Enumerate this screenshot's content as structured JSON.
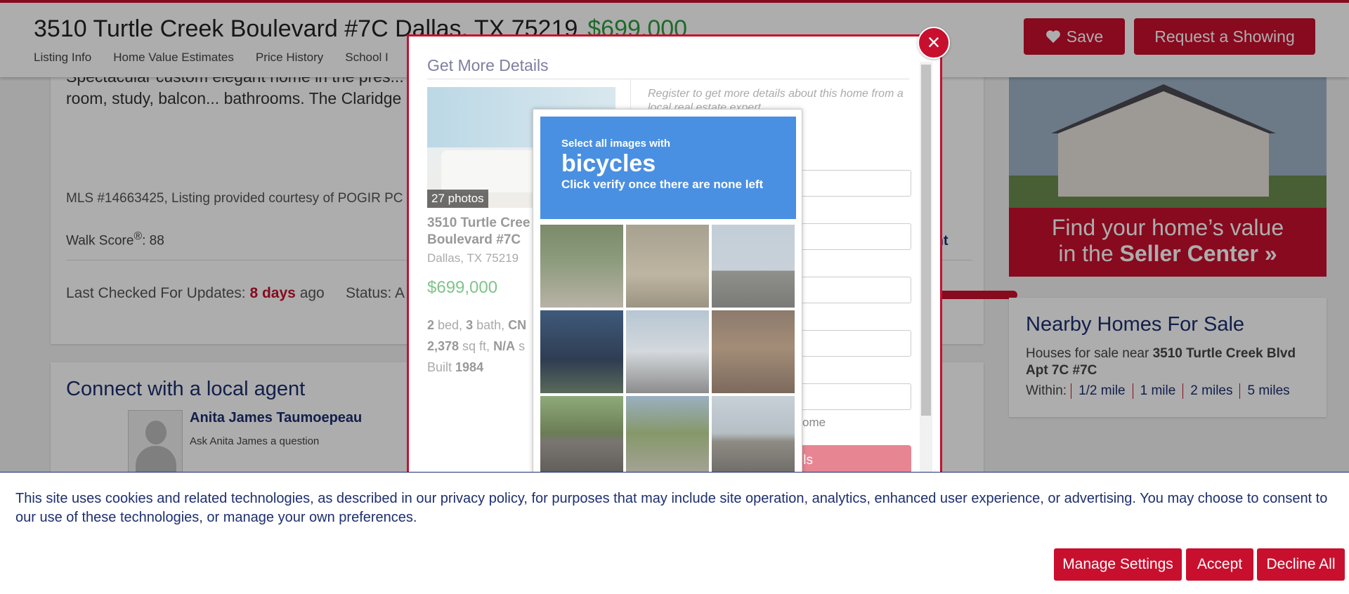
{
  "header": {
    "address": "3510 Turtle Creek Boulevard #7C Dallas, TX 75219",
    "price": "$699,000",
    "nav": [
      "Listing Info",
      "Home Value Estimates",
      "Price History",
      "School I"
    ],
    "save_label": "Save",
    "showing_label": "Request a Showing"
  },
  "description": {
    "text": "Spectacular custom elegant home in the pres... Creek. Designed for living, intimate occasions... spaces extra large dining room, study, balcon... bathrooms. The Claridge is known for its ama... court and dog park. An extraordinary opportur...",
    "mls": "MLS #14663425, Listing provided courtesy of POGIR PC",
    "walk_score_label": "Walk Score",
    "walk_score_value": ": 88",
    "print_label": "Print",
    "last_checked_label": "Last Checked For Updates: ",
    "last_checked_value": "8 days",
    "last_checked_suffix": " ago",
    "status_label": "Status: A"
  },
  "agent": {
    "section_title": "Connect with a local agent",
    "name": "Anita James Taumoepeau",
    "ask": "Ask Anita James a question"
  },
  "ad": {
    "line1": "Find your home’s value",
    "line2_prefix": "in the ",
    "line2_bold": "Seller Center »"
  },
  "nearby": {
    "title": "Nearby Homes For Sale",
    "sub_prefix": "Houses for sale near ",
    "sub_bold": "3510 Turtle Creek Blvd Apt 7C #7C",
    "within_label": "Within:",
    "options": [
      "1/2 mile",
      "1 mile",
      "2 miles",
      "5 miles"
    ]
  },
  "modal": {
    "title": "Get More Details",
    "photo_count": "27 photos",
    "address": "3510 Turtle Cree Boulevard #7C",
    "city": "Dallas, TX 75219",
    "price": "$699,000",
    "beds": "2",
    "baths": "3",
    "bath_extra": "CN",
    "sqft": "2,378",
    "lot": "N/A",
    "built": "1984",
    "register_text": "Register to get more details about this home from a local real estate expert",
    "input3_placeholder": "m",
    "home_text": "ome",
    "submit_label": "ls"
  },
  "captcha": {
    "instruction_small": "Select all images with",
    "target": "bicycles",
    "hint": "Click verify once there are none left",
    "tiles": [
      "cyclist on path",
      "bicycles parked",
      "parking lot",
      "cyclist",
      "street intersection",
      "van",
      "road with car",
      "street with trees",
      "highway"
    ]
  },
  "cookie": {
    "text": "This site uses cookies and related technologies, as described in our privacy policy, for purposes that may include site operation, analytics, enhanced user experience, or advertising. You may choose to consent to our use of these technologies, or manage your own preferences.",
    "manage_label": "Manage Settings",
    "accept_label": "Accept",
    "decline_label": "Decline All"
  },
  "colors": {
    "brand_red": "#c8102e",
    "navy": "#1d2f6f",
    "price_green": "#2e9c3f",
    "captcha_blue": "#4a90e2"
  }
}
